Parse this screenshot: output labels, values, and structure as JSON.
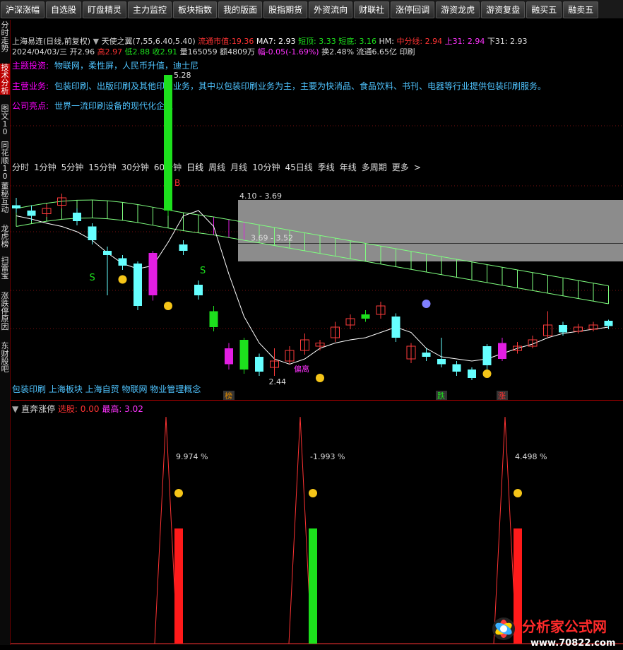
{
  "toolbar": [
    "沪深涨幅",
    "自选股",
    "盯盘精灵",
    "主力监控",
    "板块指数",
    "我的版面",
    "股指期货",
    "外资流向",
    "财联社",
    "涨停回调",
    "游资龙虎",
    "游资复盘",
    "融买五",
    "融卖五"
  ],
  "sidebar": [
    {
      "label": "分时走势",
      "active": false
    },
    {
      "label": "技术分析",
      "active": true
    },
    {
      "label": "图文10",
      "active": false
    },
    {
      "label": "同花顺10",
      "active": false
    },
    {
      "label": "董秘互动",
      "active": false
    },
    {
      "label": "龙虎榜",
      "active": false
    },
    {
      "label": "扫雷宝",
      "active": false
    },
    {
      "label": "涨跌停原因",
      "active": false
    },
    {
      "label": "东财股吧",
      "active": false
    }
  ],
  "stock": {
    "name": "上海易连(日线,前复权)",
    "indicator": "天使之翼(7,55,6.40,5.40)",
    "flow_mv_label": "流通市值:",
    "flow_mv": "19.36",
    "ma7": "MA7: 2.93",
    "short_top": "短顶: 3.33",
    "short_bottom": "短底: 3.16",
    "hm": "HM:",
    "mid": "中分线: 2.94",
    "up31": "上31: 2.94",
    "down31": "下31: 2.93",
    "date": "2024/04/03/三",
    "open": "开2.96",
    "high": "高2.97",
    "low": "低2.88",
    "close": "收2.91",
    "volume": "量165059",
    "amount": "额4809万",
    "change": "幅-0.05(-1.69%)",
    "turnover": "换2.48%",
    "float": "流通6.65亿",
    "industry": "印刷"
  },
  "annotations": [
    {
      "key": "主题投资:",
      "value": "物联网，柔性屏，人民币升值，迪士尼"
    },
    {
      "key": "主营业务:",
      "value": "包装印刷、出版印刷及其他印刷业务，其中以包装印刷业务为主，主要为快消品、食品饮料、书刊、电器等行业提供包装印刷服务。"
    },
    {
      "key": "公司亮点:",
      "value": "世界一流印刷设备的现代化企业"
    }
  ],
  "timeframes": [
    "分时",
    "1分钟",
    "5分钟",
    "15分钟",
    "30分钟",
    "60分钟",
    "日线",
    "周线",
    "月线",
    "10分钟",
    "45日线",
    "季线",
    "年线",
    "多周期",
    "更多"
  ],
  "timeframe_selected": "日线",
  "concepts": "包装印刷 上海板块 上海自贸 物联网 物业管理概念",
  "indicator2": {
    "name": "直奔涨停",
    "xuangu": "选股: 0.00",
    "high": "最高: 3.02"
  },
  "colors": {
    "up": "#ff3b3b",
    "down_cyan": "#6ff",
    "green": "#1de01d",
    "magenta": "#e21ee2",
    "wing": "#7fff7f",
    "gray_band": "#8c8c8c"
  },
  "chart_data": [
    {
      "type": "candlestick",
      "title": "上海易连(日线,前复权)",
      "price_labels": {
        "peak": "5.28",
        "box_top": "4.10 - 3.69",
        "box_mid": "3.69 - 3.52",
        "low": "2.44"
      },
      "markers": [
        "B",
        "S",
        "S",
        "偏离",
        "榜",
        "跌",
        "涨"
      ],
      "candles": [
        {
          "o": 4.05,
          "c": 4.02,
          "h": 4.12,
          "l": 3.98
        },
        {
          "o": 4.0,
          "c": 3.95,
          "h": 4.05,
          "l": 3.9
        },
        {
          "o": 3.97,
          "c": 4.02,
          "h": 4.06,
          "l": 3.94
        },
        {
          "o": 4.05,
          "c": 4.12,
          "h": 4.16,
          "l": 4.02
        },
        {
          "o": 3.98,
          "c": 3.9,
          "h": 4.02,
          "l": 3.86
        },
        {
          "o": 3.85,
          "c": 3.72,
          "h": 3.88,
          "l": 3.68
        },
        {
          "o": 3.62,
          "c": 3.58,
          "h": 3.66,
          "l": 3.2
        },
        {
          "o": 3.55,
          "c": 3.48,
          "h": 3.58,
          "l": 3.44
        },
        {
          "o": 3.5,
          "c": 3.1,
          "h": 3.52,
          "l": 3.06
        },
        {
          "o": 3.2,
          "c": 3.6,
          "h": 3.62,
          "l": 3.15
        },
        {
          "o": 4.0,
          "c": 5.28,
          "h": 5.28,
          "l": 3.95
        },
        {
          "o": 3.68,
          "c": 3.62,
          "h": 3.72,
          "l": 3.58
        },
        {
          "o": 3.3,
          "c": 3.2,
          "h": 3.34,
          "l": 3.16
        },
        {
          "o": 3.05,
          "c": 2.9,
          "h": 3.1,
          "l": 2.86
        },
        {
          "o": 2.7,
          "c": 2.55,
          "h": 2.75,
          "l": 2.5
        },
        {
          "o": 2.78,
          "c": 2.5,
          "h": 2.8,
          "l": 2.46
        },
        {
          "o": 2.62,
          "c": 2.48,
          "h": 2.65,
          "l": 2.44
        },
        {
          "o": 2.52,
          "c": 2.58,
          "h": 2.7,
          "l": 2.44
        },
        {
          "o": 2.58,
          "c": 2.68,
          "h": 2.72,
          "l": 2.55
        },
        {
          "o": 2.68,
          "c": 2.78,
          "h": 2.84,
          "l": 2.64
        },
        {
          "o": 2.72,
          "c": 2.75,
          "h": 2.78,
          "l": 2.68
        },
        {
          "o": 2.8,
          "c": 2.9,
          "h": 2.95,
          "l": 2.76
        },
        {
          "o": 2.92,
          "c": 2.98,
          "h": 3.02,
          "l": 2.88
        },
        {
          "o": 2.98,
          "c": 3.02,
          "h": 3.06,
          "l": 2.95
        },
        {
          "o": 3.02,
          "c": 3.1,
          "h": 3.14,
          "l": 2.98
        },
        {
          "o": 3.0,
          "c": 2.8,
          "h": 3.03,
          "l": 2.76
        },
        {
          "o": 2.6,
          "c": 2.72,
          "h": 2.75,
          "l": 2.56
        },
        {
          "o": 2.66,
          "c": 2.62,
          "h": 2.7,
          "l": 2.58
        },
        {
          "o": 2.6,
          "c": 2.55,
          "h": 2.8,
          "l": 2.52
        },
        {
          "o": 2.55,
          "c": 2.48,
          "h": 2.58,
          "l": 2.44
        },
        {
          "o": 2.5,
          "c": 2.42,
          "h": 2.52,
          "l": 2.4
        },
        {
          "o": 2.72,
          "c": 2.54,
          "h": 2.74,
          "l": 2.5
        },
        {
          "o": 2.6,
          "c": 2.75,
          "h": 2.8,
          "l": 2.58
        },
        {
          "o": 2.68,
          "c": 2.72,
          "h": 2.76,
          "l": 2.65
        },
        {
          "o": 2.72,
          "c": 2.78,
          "h": 2.82,
          "l": 2.7
        },
        {
          "o": 2.82,
          "c": 2.92,
          "h": 3.05,
          "l": 2.8
        },
        {
          "o": 2.92,
          "c": 2.85,
          "h": 2.95,
          "l": 2.82
        },
        {
          "o": 2.86,
          "c": 2.9,
          "h": 2.93,
          "l": 2.84
        },
        {
          "o": 2.88,
          "c": 2.92,
          "h": 2.95,
          "l": 2.86
        },
        {
          "o": 2.96,
          "c": 2.91,
          "h": 2.97,
          "l": 2.88
        }
      ]
    },
    {
      "type": "bar",
      "title": "直奔涨停",
      "value_labels": [
        "9.974 %",
        "-1.993 %",
        "4.498 %"
      ],
      "peaks": [
        3.02,
        3.02,
        3.02
      ],
      "bars": [
        1,
        1,
        1
      ],
      "bar_colors": [
        "red",
        "green",
        "red"
      ]
    }
  ]
}
